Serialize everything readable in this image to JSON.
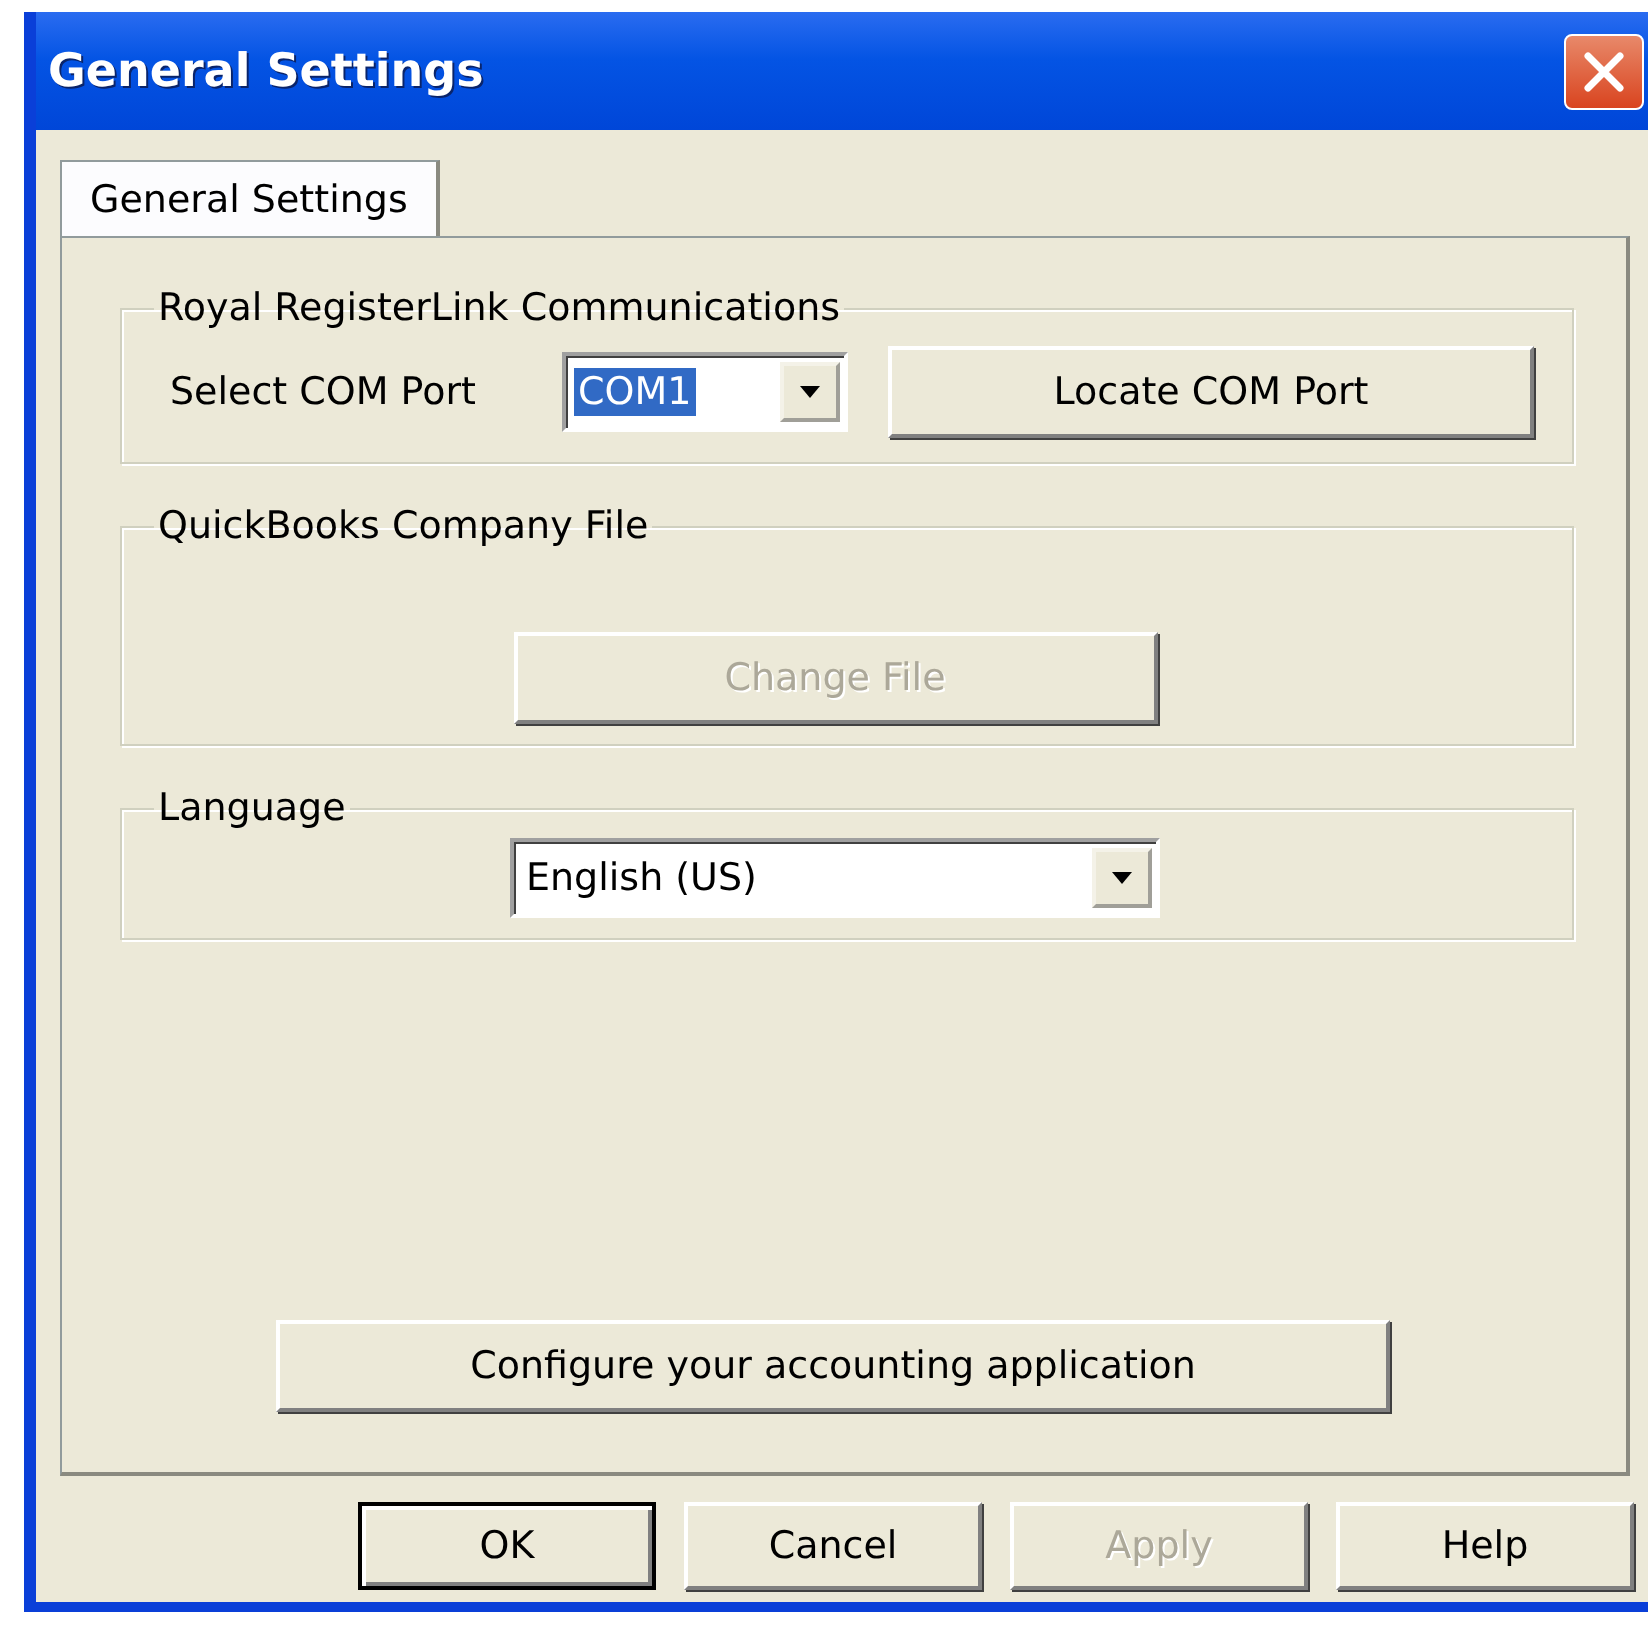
{
  "window": {
    "title": "General Settings"
  },
  "tabs": [
    {
      "label": "General Settings",
      "selected": true
    }
  ],
  "groups": [
    {
      "kind": "com",
      "title": "Royal RegisterLink Communications",
      "label": "Select COM Port",
      "combo": {
        "value": "COM1",
        "highlighted": true
      },
      "button": {
        "label": "Locate COM Port",
        "disabled": false
      }
    },
    {
      "kind": "file",
      "title": "QuickBooks Company File",
      "button": {
        "label": "Change File",
        "disabled": true
      }
    },
    {
      "kind": "language",
      "title": "Language",
      "combo": {
        "value": "English (US)",
        "highlighted": false
      }
    }
  ],
  "configure_button": {
    "label": "Configure your accounting application",
    "disabled": false
  },
  "buttons": [
    {
      "label": "OK",
      "default": true,
      "disabled": false
    },
    {
      "label": "Cancel",
      "default": false,
      "disabled": false
    },
    {
      "label": "Apply",
      "default": false,
      "disabled": true
    },
    {
      "label": "Help",
      "default": false,
      "disabled": false
    }
  ]
}
